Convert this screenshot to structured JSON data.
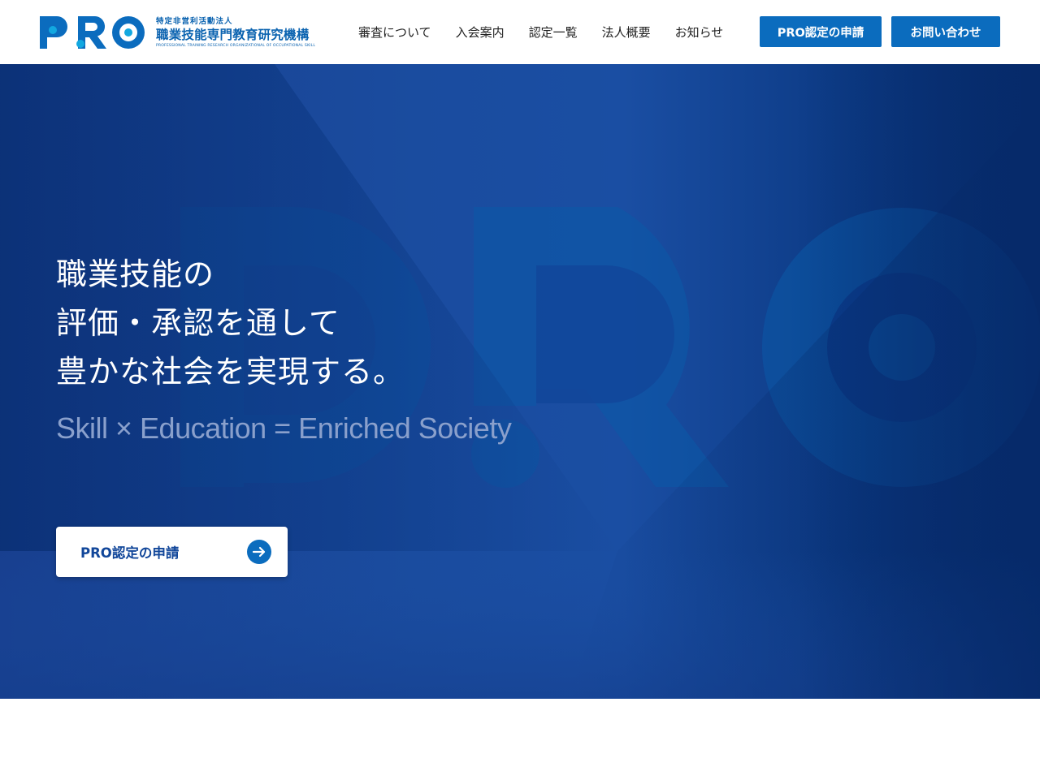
{
  "brand": {
    "logo_letters": "PRO",
    "org_type": "特定非営利活動法人",
    "org_name": "職業技能専門教育研究機構",
    "org_name_en": "PROFESSIONAL TRAINING RESEARCH ORGANIZATIONAL OF OCCUPATIONAL SKILL",
    "primary_color": "#0b6cbe",
    "accent_color": "#12a8e0"
  },
  "nav": {
    "items": [
      {
        "label": "審査について"
      },
      {
        "label": "入会案内"
      },
      {
        "label": "認定一覧"
      },
      {
        "label": "法人概要"
      },
      {
        "label": "お知らせ"
      }
    ],
    "apply_button": "PRO認定の申請",
    "contact_button": "お問い合わせ"
  },
  "hero": {
    "title_lines": [
      "職業技能の",
      "評価・承認を通して",
      "豊かな社会を実現する。"
    ],
    "subtitle": "Skill × Education = Enriched Society",
    "cta_label": "PRO認定の申請",
    "cta_icon": "arrow-right-circle-icon",
    "background_color": "#1a4c9f"
  }
}
